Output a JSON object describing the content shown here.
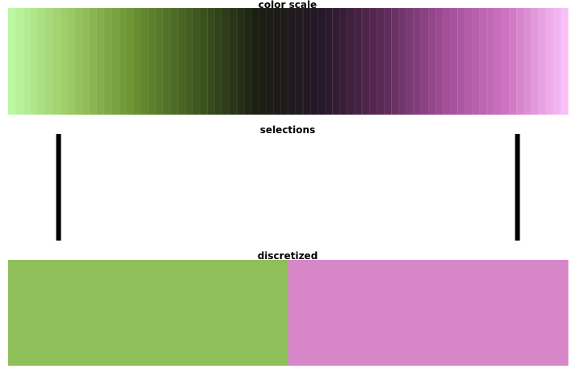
{
  "chart_data": [
    {
      "type": "heatmap",
      "title": "color scale",
      "colormap": "diverging green-black-magenta",
      "stops": [
        "#bdfba6",
        "#9bc963",
        "#6b9233",
        "#3f5920",
        "#1a1f12",
        "#241727",
        "#5a2a55",
        "#a04d96",
        "#cd72c0",
        "#fac5f9"
      ],
      "bins": 76
    },
    {
      "type": "bar",
      "title": "selections",
      "selections": [
        0.09,
        0.91
      ],
      "color": "#000000"
    },
    {
      "type": "heatmap",
      "title": "discretized",
      "segments": [
        {
          "color": "#8fbf59"
        },
        {
          "color": "#d787c8"
        }
      ]
    }
  ]
}
